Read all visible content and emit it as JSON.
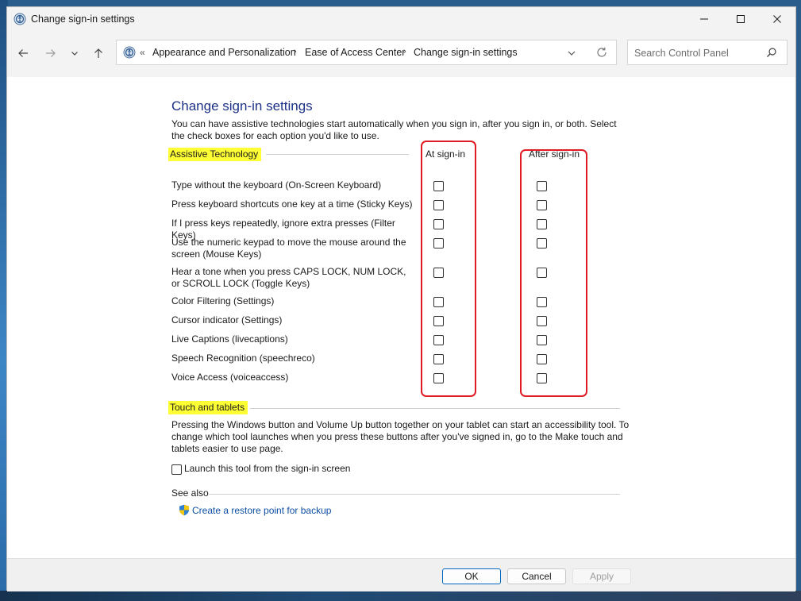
{
  "window": {
    "title": "Change sign-in settings"
  },
  "address": {
    "breadcrumbs": [
      "Appearance and Personalization",
      "Ease of Access Center",
      "Change sign-in settings"
    ]
  },
  "search": {
    "placeholder": "Search Control Panel",
    "value": ""
  },
  "page": {
    "title": "Change sign-in settings",
    "intro": "You can have assistive technologies start automatically when you sign in, after you sign in, or both. Select the check boxes for each option you'd like to use."
  },
  "assistive": {
    "heading": "Assistive Technology",
    "col_at": "At sign-in",
    "col_after": "After sign-in",
    "rows": [
      {
        "label": "Type without the keyboard (On-Screen Keyboard)",
        "at": false,
        "after": false
      },
      {
        "label": "Press keyboard shortcuts one key at a time (Sticky Keys)",
        "at": false,
        "after": false
      },
      {
        "label": "If I press keys repeatedly, ignore extra presses (Filter Keys)",
        "at": false,
        "after": false
      },
      {
        "label": "Use the numeric keypad to move the mouse around the screen (Mouse Keys)",
        "at": false,
        "after": false
      },
      {
        "label": "Hear a tone when you press CAPS LOCK, NUM LOCK, or SCROLL LOCK (Toggle Keys)",
        "at": false,
        "after": false
      },
      {
        "label": "Color Filtering (Settings)",
        "at": false,
        "after": false
      },
      {
        "label": "Cursor indicator (Settings)",
        "at": false,
        "after": false
      },
      {
        "label": "Live Captions (livecaptions)",
        "at": false,
        "after": false
      },
      {
        "label": "Speech Recognition (speechreco)",
        "at": false,
        "after": false
      },
      {
        "label": "Voice Access (voiceaccess)",
        "at": false,
        "after": false
      }
    ]
  },
  "touch": {
    "heading": "Touch and tablets",
    "description": "Pressing the Windows button and Volume Up button together on your tablet can start an accessibility tool. To change which tool launches when you press these buttons after you've signed in, go to the Make touch and tablets easier to use page.",
    "launch_label": "Launch this tool from the sign-in screen",
    "launch_checked": false
  },
  "see_also": {
    "heading": "See also",
    "link": "Create a restore point for backup"
  },
  "buttons": {
    "ok": "OK",
    "cancel": "Cancel",
    "apply": "Apply"
  },
  "colors": {
    "title_blue": "#1e3287",
    "link_blue": "#0d4fa3",
    "highlight": "#ffff36",
    "annotation_red": "#e01b24"
  }
}
